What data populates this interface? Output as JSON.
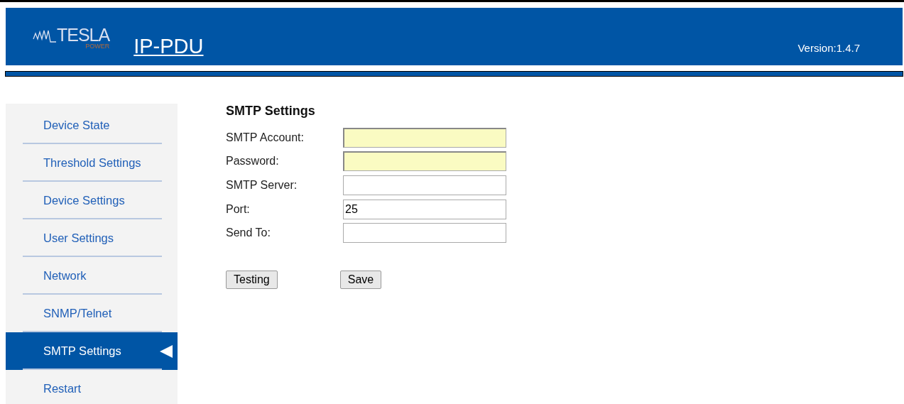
{
  "header": {
    "logo": {
      "name": "TESLA",
      "sub": "POWER"
    },
    "title": "IP-PDU",
    "version": "Version:1.4.7"
  },
  "sidebar": {
    "items": [
      {
        "label": "Device State",
        "selected": false
      },
      {
        "label": "Threshold Settings",
        "selected": false
      },
      {
        "label": "Device Settings",
        "selected": false
      },
      {
        "label": "User Settings",
        "selected": false
      },
      {
        "label": "Network",
        "selected": false
      },
      {
        "label": "SNMP/Telnet",
        "selected": false
      },
      {
        "label": "SMTP Settings",
        "selected": true
      },
      {
        "label": "Restart",
        "selected": false
      }
    ]
  },
  "form": {
    "title": "SMTP Settings",
    "fields": [
      {
        "label": "SMTP Account:",
        "autofilled": true
      },
      {
        "label": "Password:",
        "autofilled": true
      },
      {
        "label": "SMTP Server:",
        "autofilled": false
      },
      {
        "label": "Port:",
        "value": "25",
        "autofilled": false
      },
      {
        "label": "Send To:",
        "autofilled": false
      }
    ],
    "buttons": [
      "Testing",
      "Save"
    ]
  }
}
